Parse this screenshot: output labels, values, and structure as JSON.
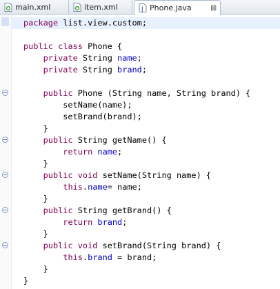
{
  "tabs": [
    {
      "label": "main.xml",
      "icon": "xml-file-icon",
      "active": false
    },
    {
      "label": "item.xml",
      "icon": "xml-file-icon",
      "active": false
    },
    {
      "label": "Phone.java",
      "icon": "java-file-icon",
      "active": true
    }
  ],
  "colors": {
    "keyword": "#7f0055",
    "field": "#0000c0",
    "text": "#000000",
    "current_line": "#e8f2fe"
  },
  "code": [
    [
      {
        "t": "package",
        "c": "kw"
      },
      {
        "t": " list.view.custom;",
        "c": "pl"
      }
    ],
    [],
    [
      {
        "t": "public",
        "c": "kw"
      },
      {
        "t": " ",
        "c": "pl"
      },
      {
        "t": "class",
        "c": "kw"
      },
      {
        "t": " Phone {",
        "c": "pl"
      }
    ],
    [
      {
        "t": "    ",
        "c": "pl"
      },
      {
        "t": "private",
        "c": "kw"
      },
      {
        "t": " String ",
        "c": "pl"
      },
      {
        "t": "name",
        "c": "fld"
      },
      {
        "t": ";",
        "c": "pl"
      }
    ],
    [
      {
        "t": "    ",
        "c": "pl"
      },
      {
        "t": "private",
        "c": "kw"
      },
      {
        "t": " String ",
        "c": "pl"
      },
      {
        "t": "brand",
        "c": "fld"
      },
      {
        "t": ";",
        "c": "pl"
      }
    ],
    [],
    [
      {
        "t": "    ",
        "c": "pl"
      },
      {
        "t": "public",
        "c": "kw"
      },
      {
        "t": " Phone (String name, String brand) {",
        "c": "pl"
      }
    ],
    [
      {
        "t": "        setName(name);",
        "c": "pl"
      }
    ],
    [
      {
        "t": "        setBrand(brand);",
        "c": "pl"
      }
    ],
    [
      {
        "t": "    }",
        "c": "pl"
      }
    ],
    [
      {
        "t": "    ",
        "c": "pl"
      },
      {
        "t": "public",
        "c": "kw"
      },
      {
        "t": " String getName() {",
        "c": "pl"
      }
    ],
    [
      {
        "t": "        ",
        "c": "pl"
      },
      {
        "t": "return",
        "c": "kw"
      },
      {
        "t": " ",
        "c": "pl"
      },
      {
        "t": "name",
        "c": "fld"
      },
      {
        "t": ";",
        "c": "pl"
      }
    ],
    [
      {
        "t": "    }",
        "c": "pl"
      }
    ],
    [
      {
        "t": "    ",
        "c": "pl"
      },
      {
        "t": "public",
        "c": "kw"
      },
      {
        "t": " ",
        "c": "pl"
      },
      {
        "t": "void",
        "c": "kw"
      },
      {
        "t": " setName(String name) {",
        "c": "pl"
      }
    ],
    [
      {
        "t": "        ",
        "c": "pl"
      },
      {
        "t": "this",
        "c": "kw"
      },
      {
        "t": ".",
        "c": "pl"
      },
      {
        "t": "name",
        "c": "fld"
      },
      {
        "t": "= name;",
        "c": "pl"
      }
    ],
    [
      {
        "t": "    }",
        "c": "pl"
      }
    ],
    [
      {
        "t": "    ",
        "c": "pl"
      },
      {
        "t": "public",
        "c": "kw"
      },
      {
        "t": " String getBrand() {",
        "c": "pl"
      }
    ],
    [
      {
        "t": "        ",
        "c": "pl"
      },
      {
        "t": "return",
        "c": "kw"
      },
      {
        "t": " ",
        "c": "pl"
      },
      {
        "t": "brand",
        "c": "fld"
      },
      {
        "t": ";",
        "c": "pl"
      }
    ],
    [
      {
        "t": "    }",
        "c": "pl"
      }
    ],
    [
      {
        "t": "    ",
        "c": "pl"
      },
      {
        "t": "public",
        "c": "kw"
      },
      {
        "t": " ",
        "c": "pl"
      },
      {
        "t": "void",
        "c": "kw"
      },
      {
        "t": " setBrand(String brand) {",
        "c": "pl"
      }
    ],
    [
      {
        "t": "        ",
        "c": "pl"
      },
      {
        "t": "this",
        "c": "kw"
      },
      {
        "t": ".",
        "c": "pl"
      },
      {
        "t": "brand",
        "c": "fld"
      },
      {
        "t": " = brand;",
        "c": "pl"
      }
    ],
    [
      {
        "t": "    }",
        "c": "pl"
      }
    ],
    [
      {
        "t": "}",
        "c": "pl"
      }
    ]
  ]
}
